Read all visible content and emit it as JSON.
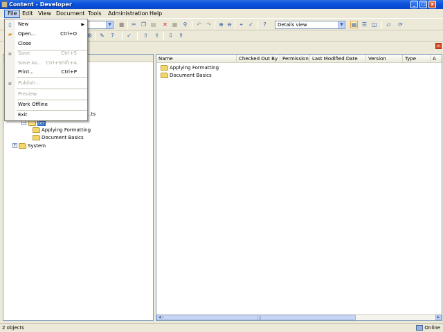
{
  "window": {
    "title": "Content - Developer",
    "controls": {
      "minimize": "_",
      "maximize": "□",
      "close": "x"
    }
  },
  "menubar": [
    "File",
    "Edit",
    "View",
    "Document",
    "Tools",
    "Administration",
    "Help"
  ],
  "file_menu": [
    {
      "label": "New",
      "shortcut": "",
      "enabled": true,
      "submenu": true,
      "icon": "new-document-icon"
    },
    {
      "label": "Open...",
      "shortcut": "Ctrl+O",
      "enabled": true,
      "icon": "open-folder-icon"
    },
    {
      "label": "Close",
      "shortcut": "",
      "enabled": true
    },
    {
      "label": "Save",
      "shortcut": "Ctrl+S",
      "enabled": false,
      "icon": "save-icon"
    },
    {
      "label": "Save As...",
      "shortcut": "Ctrl+Shift+A",
      "enabled": false
    },
    {
      "label": "Print...",
      "shortcut": "Ctrl+P",
      "enabled": true
    },
    {
      "label": "Publish...",
      "shortcut": "",
      "enabled": false,
      "icon": "publish-icon"
    },
    {
      "label": "Preview",
      "shortcut": "",
      "enabled": false
    },
    {
      "label": "Work Offline",
      "shortcut": "",
      "enabled": true
    },
    {
      "label": "Exit",
      "shortcut": "",
      "enabled": true
    }
  ],
  "toolbar": {
    "view_combo": {
      "value": "Details view"
    }
  },
  "tree": {
    "nodes": [
      {
        "label": "...ts",
        "level": 1
      },
      {
        "label": "ter",
        "level": 2,
        "selected": true
      },
      {
        "label": "Applying Formatting",
        "level": 3
      },
      {
        "label": "Document Basics",
        "level": 3
      },
      {
        "label": "System",
        "level": 0
      }
    ]
  },
  "list": {
    "columns": [
      "Name",
      "Checked Out By",
      "Permission",
      "Last Modified Date",
      "Version",
      "Type"
    ],
    "rows": [
      {
        "name": "Applying Formatting"
      },
      {
        "name": "Document Basics"
      }
    ]
  },
  "status": {
    "count": "2 objects",
    "mode": "Online"
  },
  "colors": {
    "titlebar": "#0a54e0",
    "selection": "#316ac5",
    "menu_highlight": "#c1d2ee",
    "folder": "#f5d66a"
  }
}
